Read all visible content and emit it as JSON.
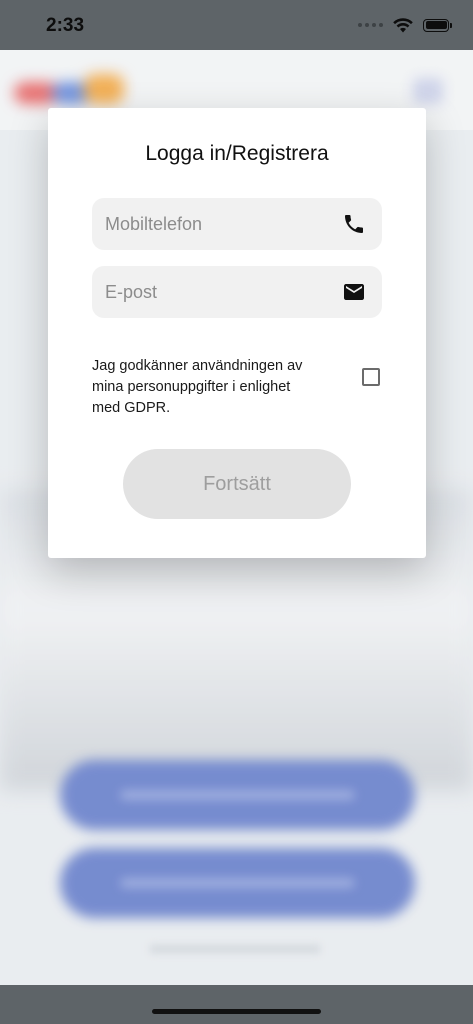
{
  "status_bar": {
    "time": "2:33"
  },
  "login_modal": {
    "title": "Logga in/Registrera",
    "phone_field": {
      "placeholder": "Mobiltelefon",
      "value": "",
      "icon": "phone-icon"
    },
    "email_field": {
      "placeholder": "E-post",
      "value": "",
      "icon": "mail-icon"
    },
    "consent_text": "Jag godkänner användningen av mina personuppgifter i enlighet med GDPR.",
    "consent_checked": false,
    "continue_label": "Fortsätt"
  },
  "colors": {
    "continue_disabled_bg": "#e2e2e2",
    "continue_disabled_text": "#9e9e9e",
    "background_button": "#5f78c7"
  }
}
